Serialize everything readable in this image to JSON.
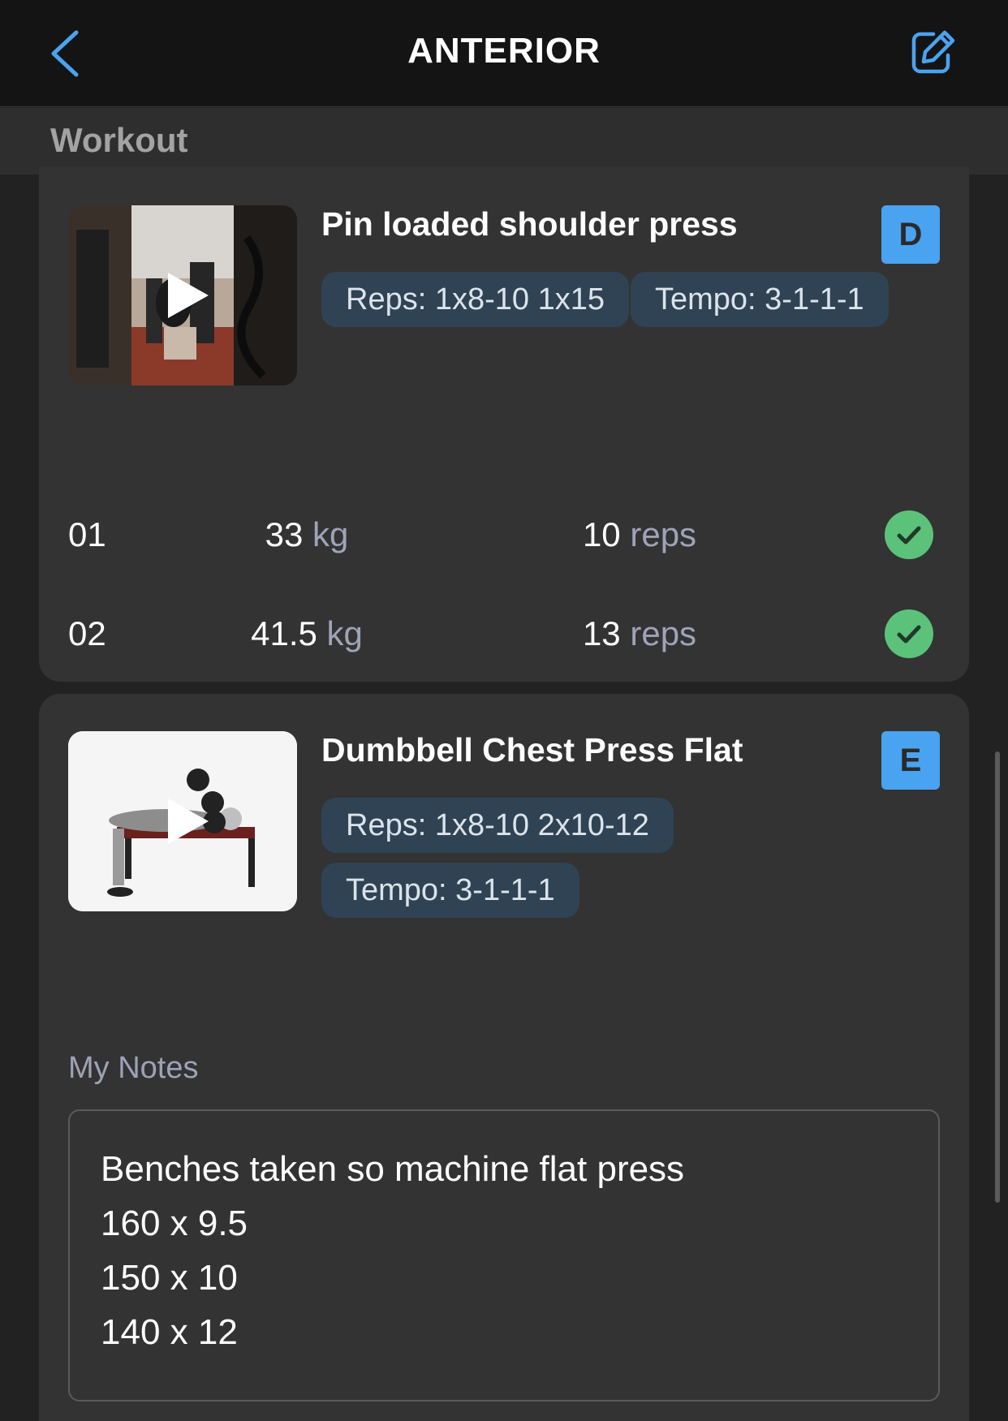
{
  "header": {
    "title": "ANTERIOR",
    "back_icon": "chevron-left-icon",
    "edit_icon": "edit-icon",
    "accent_color": "#4aa3f0"
  },
  "section": {
    "label": "Workout"
  },
  "exercises": [
    {
      "name": "Pin loaded shoulder press",
      "badge": "D",
      "pills": [
        "Reps: 1x8-10 1x15",
        "Tempo: 3-1-1-1"
      ],
      "thumbnail_icon": "play-icon",
      "sets": [
        {
          "num": "01",
          "weight": "33",
          "weight_unit": "kg",
          "reps": "10",
          "reps_unit": "reps",
          "done": true
        },
        {
          "num": "02",
          "weight": "41.5",
          "weight_unit": "kg",
          "reps": "13",
          "reps_unit": "reps",
          "done": true
        }
      ]
    },
    {
      "name": "Dumbbell Chest Press Flat",
      "badge": "E",
      "pills": [
        "Reps: 1x8-10 2x10-12",
        "Tempo: 3-1-1-1"
      ],
      "thumbnail_icon": "play-icon",
      "notes_label": "My Notes",
      "notes_lines": [
        "Benches taken so machine flat press",
        "160 x 9.5",
        "150 x 10",
        "140 x 12"
      ]
    }
  ],
  "colors": {
    "background": "#222222",
    "card": "#333333",
    "pill": "#2f4354",
    "check": "#5cc27a"
  }
}
